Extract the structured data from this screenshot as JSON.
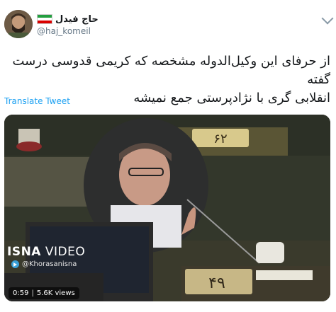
{
  "tweet": {
    "display_name": "حاج فیدل",
    "handle": "@haj_komeil",
    "text_line1": "از حرفای این وکیل‌الدوله مشخصه که کریمی قدوسی درست گفته",
    "text_line2": "انقلابی گری با نژادپرستی جمع نمیشه",
    "translate_label": "Translate Tweet"
  },
  "video": {
    "watermark_title_bold": "ISNA",
    "watermark_title_light": " VIDEO",
    "watermark_channel": "@Khorasanisna",
    "desk_number_back": "۶۲",
    "desk_number_front": "۴۹",
    "duration": "0:59",
    "views": "5.6K views"
  },
  "colors": {
    "link": "#1da1f2",
    "secondary_text": "#657786"
  }
}
